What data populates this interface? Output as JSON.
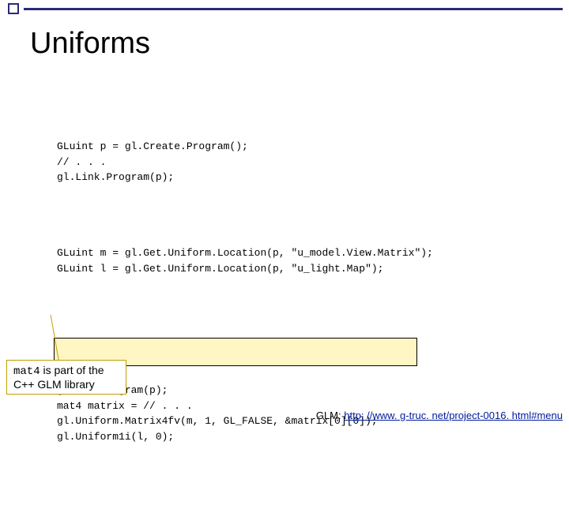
{
  "title": "Uniforms",
  "code": {
    "block1": {
      "l1": "GLuint p = gl.Create.Program();",
      "l2": "// . . .",
      "l3": "gl.Link.Program(p);"
    },
    "block2": {
      "l1": "GLuint m = gl.Get.Uniform.Location(p, \"u_model.View.Matrix\");",
      "l2": "GLuint l = gl.Get.Uniform.Location(p, \"u_light.Map\");"
    },
    "block3": {
      "l1": "gl.Use.Program(p);",
      "l2": "mat4 matrix = // . . .",
      "l3": "gl.Uniform.Matrix4fv(m, 1, GL_FALSE, &matrix[0][0]);",
      "l4": "gl.Uniform1i(l, 0);"
    }
  },
  "callout": {
    "mono": "mat4",
    "rest": " is part of the C++ GLM library"
  },
  "footer": {
    "label": "GLM:  ",
    "link": "http: //www. g-truc. net/project-0016. html#menu"
  }
}
